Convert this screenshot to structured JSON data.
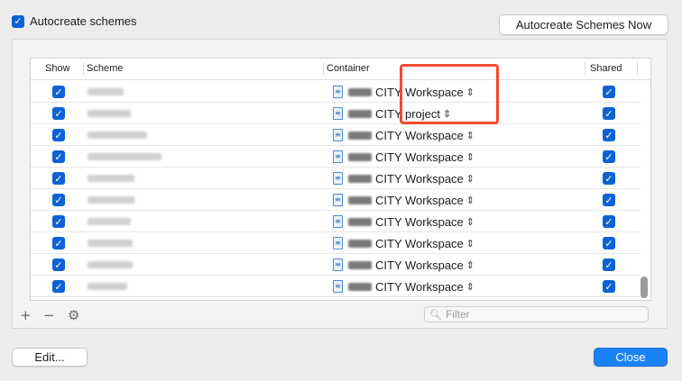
{
  "autocreate": {
    "label": "Autocreate schemes",
    "checked": true
  },
  "buttons": {
    "autocreate_now": "Autocreate Schemes Now",
    "edit": "Edit...",
    "close": "Close"
  },
  "table": {
    "headers": {
      "show": "Show",
      "scheme": "Scheme",
      "container": "Container",
      "shared": "Shared"
    },
    "rows": [
      {
        "show": true,
        "shared": true,
        "container": "CITY Workspace"
      },
      {
        "show": true,
        "shared": true,
        "container": "CITY project"
      },
      {
        "show": true,
        "shared": true,
        "container": "CITY Workspace"
      },
      {
        "show": true,
        "shared": true,
        "container": "CITY Workspace"
      },
      {
        "show": true,
        "shared": true,
        "container": "CITY Workspace"
      },
      {
        "show": true,
        "shared": true,
        "container": "CITY Workspace"
      },
      {
        "show": true,
        "shared": true,
        "container": "CITY Workspace"
      },
      {
        "show": true,
        "shared": true,
        "container": "CITY Workspace"
      },
      {
        "show": true,
        "shared": true,
        "container": "CITY Workspace"
      },
      {
        "show": true,
        "shared": true,
        "container": "CITY Workspace"
      }
    ]
  },
  "toolbar": {
    "add_symbol": "+",
    "remove_symbol": "−",
    "settings_symbol": "⚙"
  },
  "filter": {
    "placeholder": "Filter"
  },
  "colors": {
    "accent": "#0a62d6",
    "highlight": "#f04b30",
    "close_button": "#1a82f7"
  }
}
